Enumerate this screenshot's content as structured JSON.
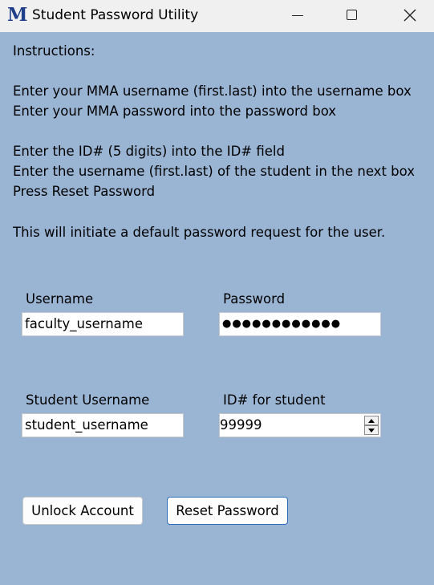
{
  "window": {
    "logo": "M",
    "title": "Student Password Utility"
  },
  "instructions": {
    "heading": "Instructions:",
    "line1": "Enter your MMA username (first.last) into the username box",
    "line2": "Enter your MMA password into the password box",
    "line3": "Enter the ID# (5 digits) into the ID# field",
    "line4": "Enter the username (first.last) of the student in the next box",
    "line5": "Press Reset Password",
    "line6": "This will initiate a default password request for the user."
  },
  "form": {
    "username_label": "Username",
    "username_value": "faculty_username",
    "password_label": "Password",
    "password_value": "●●●●●●●●●●●●",
    "student_username_label": "Student Username",
    "student_username_value": "student_username",
    "id_label": "ID# for student",
    "id_value": "99999"
  },
  "buttons": {
    "unlock": "Unlock Account",
    "reset": "Reset Password"
  },
  "colors": {
    "background": "#9ab5d4",
    "titlebar": "#f0f0f0",
    "logo": "#1f3f8a",
    "default_button_border": "#2a6ebc"
  },
  "icons": {
    "app": "app-logo-icon",
    "minimize": "minimize-icon",
    "maximize": "maximize-icon",
    "close": "close-icon",
    "spin_up": "chevron-up-icon",
    "spin_down": "chevron-down-icon"
  }
}
